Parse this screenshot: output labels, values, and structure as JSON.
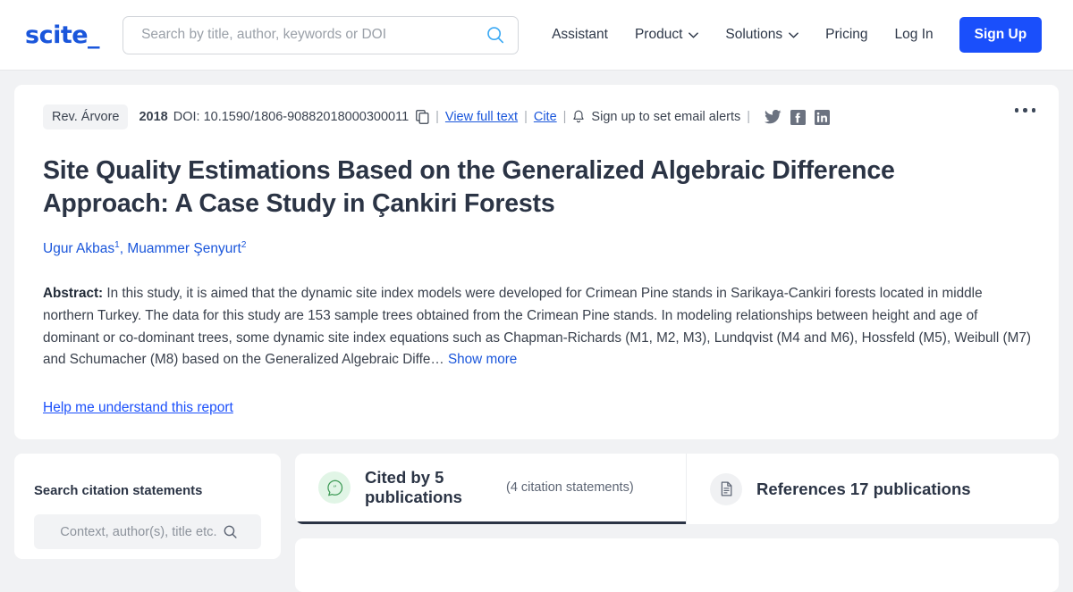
{
  "header": {
    "logo_text": "scite_",
    "search": {
      "placeholder": "Search by title, author, keywords or DOI",
      "value": "",
      "icon": "search-icon"
    },
    "nav": [
      {
        "label": "Assistant",
        "has_caret": false
      },
      {
        "label": "Product",
        "has_caret": true
      },
      {
        "label": "Solutions",
        "has_caret": true
      },
      {
        "label": "Pricing",
        "has_caret": false
      },
      {
        "label": "Log In",
        "has_caret": false
      }
    ],
    "signup_label": "Sign Up",
    "signup_color": "#1a4ffb"
  },
  "paper": {
    "journal": "Rev. Árvore",
    "year": "2018",
    "doi": "DOI: 10.1590/1806-90882018000300011",
    "copy_icon": "copy-icon",
    "view_full_text": "View full text",
    "cite": "Cite",
    "bell_icon": "bell-icon",
    "alerts_label": "Sign up to set email alerts",
    "separator": "|",
    "socials": [
      {
        "name": "twitter-icon"
      },
      {
        "name": "facebook-icon"
      },
      {
        "name": "linkedin-icon"
      }
    ],
    "title": "Site Quality Estimations Based on the Generalized Algebraic Difference Approach: A Case Study in Çankiri Forests",
    "authors": [
      {
        "name": "Ugur Akbas",
        "sup": "1"
      },
      {
        "name": "Muammer Şenyurt",
        "sup": "2"
      }
    ],
    "abstract_label": "Abstract:",
    "abstract_text": " In this study, it is aimed that the dynamic site index models were developed for Crimean Pine stands in Sarikaya-Cankiri forests located in middle northern Turkey. The data for this study are 153 sample trees obtained from the Crimean Pine stands. In modeling relationships between height and age of dominant or co-dominant trees, some dynamic site index equations such as Chapman-Richards (M1, M2, M3), Lundqvist (M4 and M6), Hossfeld (M5), Weibull (M7) and Schumacher (M8) based on the Generalized Algebraic Diffe… ",
    "show_more": "Show more",
    "help_link": "Help me understand this report",
    "kebab_icon": "more-options-icon"
  },
  "sidebar": {
    "title": "Search citation statements",
    "search_placeholder": "Context, author(s), title etc.",
    "search_value": "",
    "search_icon": "search-icon"
  },
  "tabs": [
    {
      "id": "cited-by",
      "icon": "citation-bubble-icon",
      "label": "Cited by 5 publications",
      "sublabel": "(4 citation statements)",
      "active": true,
      "accent": "#2b3445"
    },
    {
      "id": "references",
      "icon": "document-icon",
      "label": "References 17 publications",
      "sublabel": "",
      "active": false
    }
  ]
}
